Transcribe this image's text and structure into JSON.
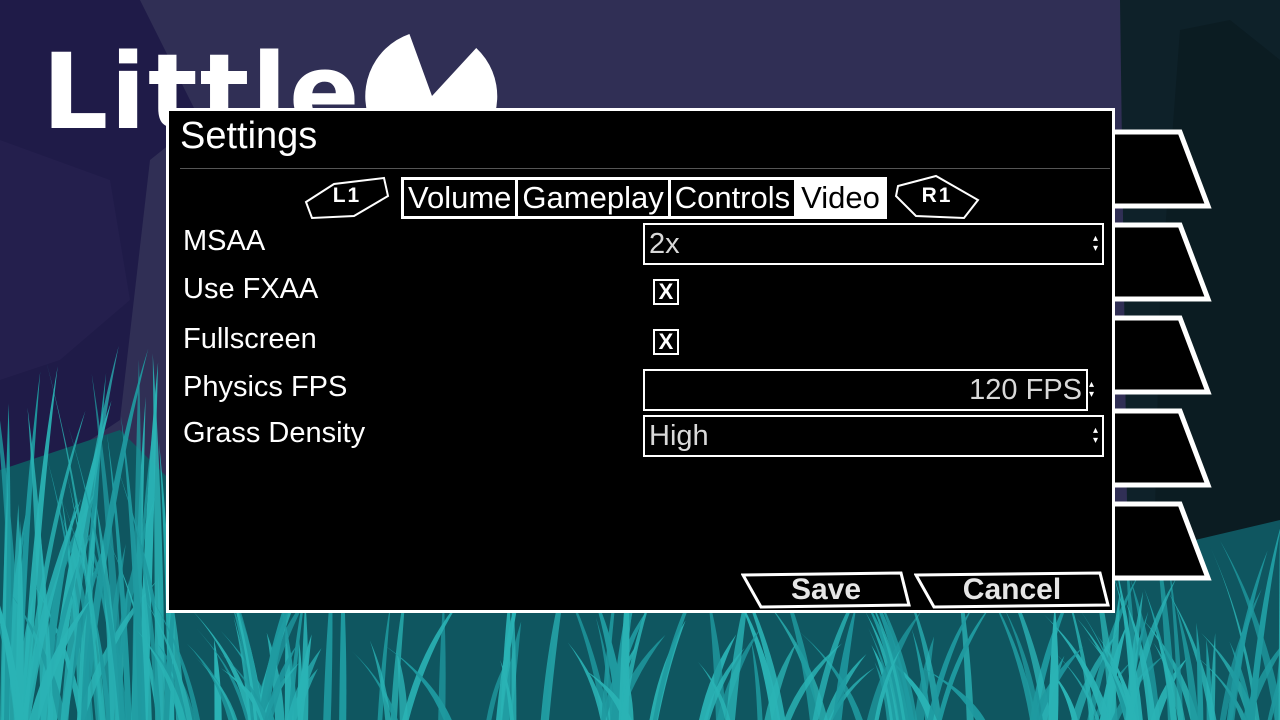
{
  "app": {
    "logo_text": "Little"
  },
  "settings": {
    "title": "Settings",
    "tabs": [
      {
        "label": "Volume",
        "active": false
      },
      {
        "label": "Gameplay",
        "active": false
      },
      {
        "label": "Controls",
        "active": false
      },
      {
        "label": "Video",
        "active": true
      }
    ],
    "prev_tab_hint": "L1",
    "next_tab_hint": "R1",
    "rows": {
      "msaa": {
        "label": "MSAA",
        "value": "2x"
      },
      "fxaa": {
        "label": "Use FXAA",
        "checked": true,
        "mark": "X"
      },
      "fullscreen": {
        "label": "Fullscreen",
        "checked": true,
        "mark": "X"
      },
      "physics_fps": {
        "label": "Physics FPS",
        "value": "120 FPS"
      },
      "grass_density": {
        "label": "Grass Density",
        "value": "High"
      }
    },
    "save_label": "Save",
    "cancel_label": "Cancel"
  },
  "theme": {
    "sky": "#2d2c52",
    "grass": "#2ab3b5",
    "panel_bg": "#000000",
    "accent": "#ffffff"
  }
}
